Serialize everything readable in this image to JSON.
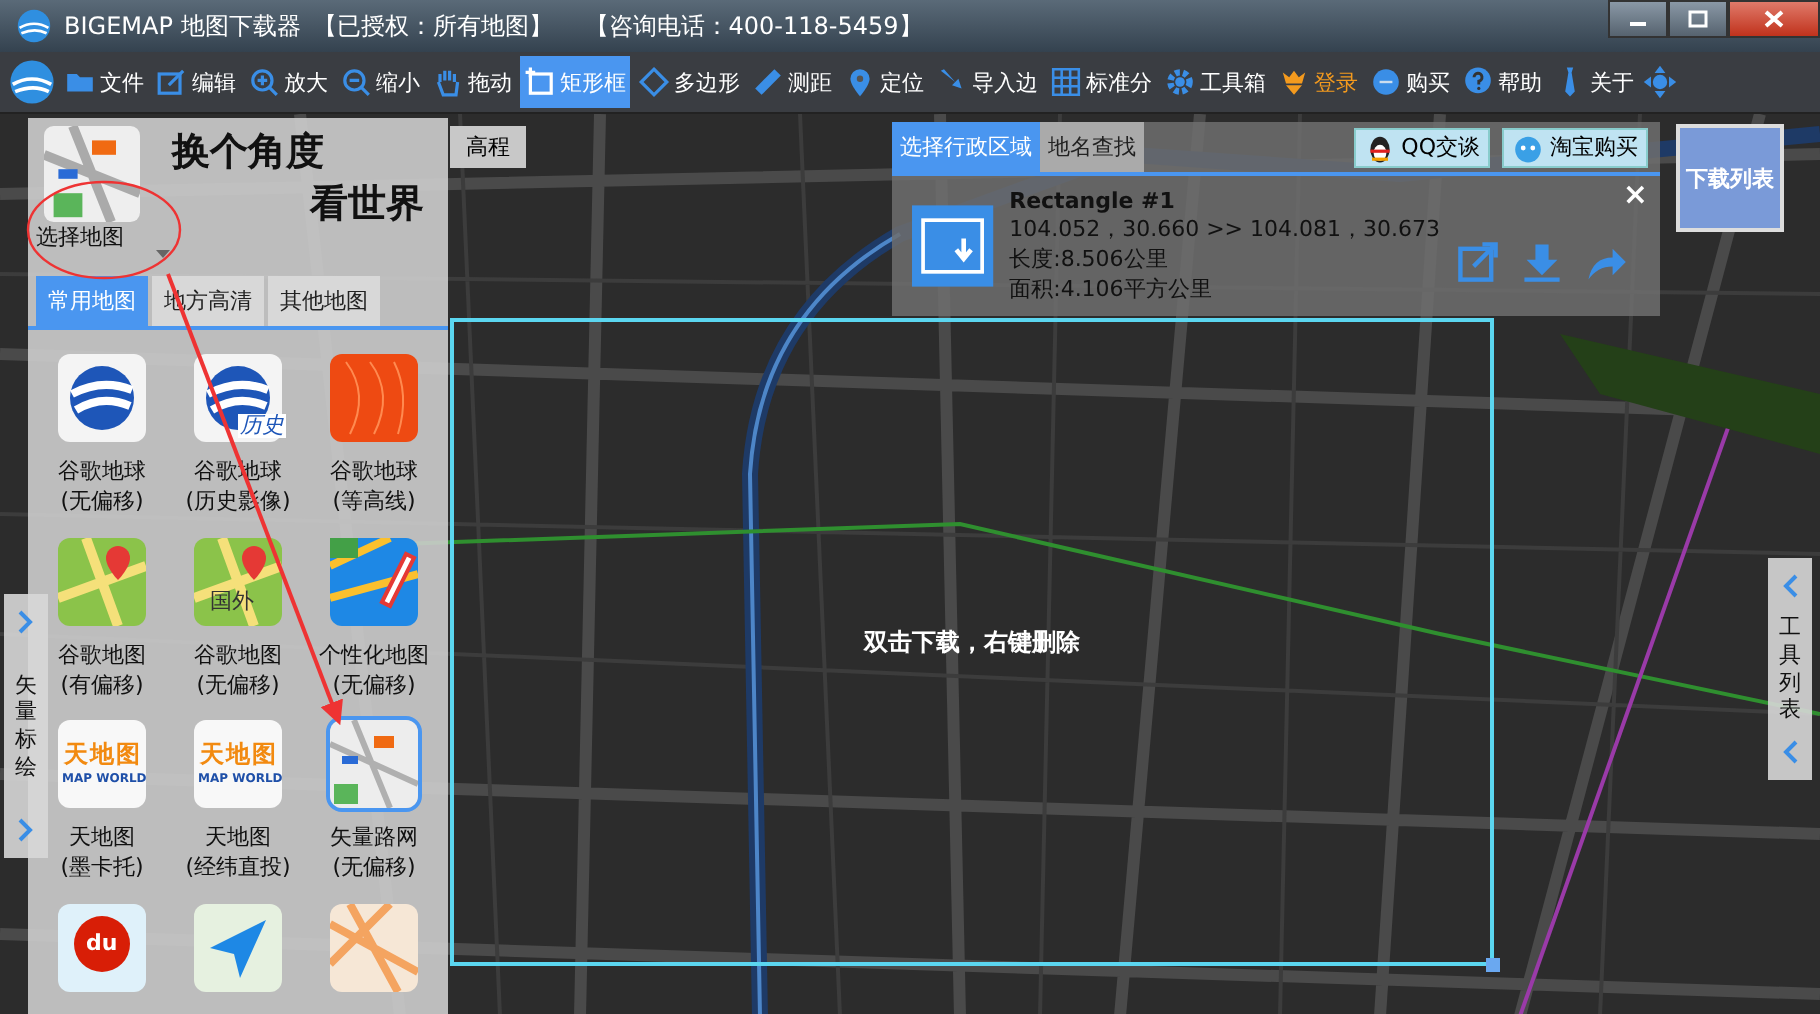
{
  "window": {
    "title": "BIGEMAP 地图下载器",
    "license": "【已授权：所有地图】",
    "phone": "【咨询电话：400-118-5459】"
  },
  "toolbar": [
    {
      "label": "文件",
      "selected": false,
      "accent": false
    },
    {
      "label": "编辑",
      "selected": false,
      "accent": false
    },
    {
      "label": "放大",
      "selected": false,
      "accent": false
    },
    {
      "label": "缩小",
      "selected": false,
      "accent": false
    },
    {
      "label": "拖动",
      "selected": false,
      "accent": false
    },
    {
      "label": "矩形框",
      "selected": true,
      "accent": false
    },
    {
      "label": "多边形",
      "selected": false,
      "accent": false
    },
    {
      "label": "测距",
      "selected": false,
      "accent": false
    },
    {
      "label": "定位",
      "selected": false,
      "accent": false
    },
    {
      "label": "导入边",
      "selected": false,
      "accent": false
    },
    {
      "label": "标准分",
      "selected": false,
      "accent": false
    },
    {
      "label": "工具箱",
      "selected": false,
      "accent": false
    },
    {
      "label": "登录",
      "selected": false,
      "accent": true
    },
    {
      "label": "购买",
      "selected": false,
      "accent": false
    },
    {
      "label": "帮助",
      "selected": false,
      "accent": false
    },
    {
      "label": "关于",
      "selected": false,
      "accent": false
    }
  ],
  "left_panel": {
    "picker_label": "选择地图",
    "slogan": [
      "换个角度",
      "看世界"
    ],
    "elevation_tab": "高程",
    "tabs": [
      {
        "label": "常用地图",
        "selected": true
      },
      {
        "label": "地方高清",
        "selected": false
      },
      {
        "label": "其他地图",
        "selected": false
      }
    ],
    "maps": [
      {
        "kind": "earth",
        "lines": [
          "谷歌地球",
          "(无偏移)"
        ],
        "selected": false
      },
      {
        "kind": "earth-history",
        "icon_text": "历史",
        "lines": [
          "谷歌地球",
          "(历史影像)"
        ],
        "selected": false
      },
      {
        "kind": "contour",
        "lines": [
          "谷歌地球",
          "(等高线)"
        ],
        "selected": false
      },
      {
        "kind": "gmap",
        "lines": [
          "谷歌地图",
          "(有偏移)"
        ],
        "selected": false
      },
      {
        "kind": "gmap",
        "icon_text": "国外",
        "lines": [
          "谷歌地图",
          "(无偏移)"
        ],
        "selected": false
      },
      {
        "kind": "custom",
        "lines": [
          "个性化地图",
          "(无偏移)"
        ],
        "selected": false
      },
      {
        "kind": "tianditu",
        "icon_text": "天地图",
        "icon_subtext": "MAP WORLD",
        "lines": [
          "天地图",
          "(墨卡托)"
        ],
        "selected": false
      },
      {
        "kind": "tianditu",
        "icon_text": "天地图",
        "icon_subtext": "MAP WORLD",
        "lines": [
          "天地图",
          "(经纬直投)"
        ],
        "selected": false
      },
      {
        "kind": "vector",
        "lines": [
          "矢量路网",
          "(无偏移)"
        ],
        "selected": true
      },
      {
        "kind": "baidu",
        "icon_text": "du",
        "selected": false
      },
      {
        "kind": "plane",
        "selected": false
      },
      {
        "kind": "street",
        "selected": false
      }
    ]
  },
  "left_side_tab": "矢量标绘",
  "right_side_tab": "工具列表",
  "region_panel": {
    "tabs": [
      {
        "label": "选择行政区域",
        "selected": true
      },
      {
        "label": "地名查找",
        "selected": false
      }
    ],
    "buttons": [
      {
        "label": "QQ交谈"
      },
      {
        "label": "淘宝购买"
      }
    ],
    "card": {
      "title": "Rectangle #1",
      "coords": "104.052，30.660 >> 104.081，30.673",
      "length": "长度:8.506公里",
      "area": "面积:4.106平方公里",
      "close": "×"
    }
  },
  "download_list_button": "下载列表",
  "selection": {
    "hint": "双击下载，右键删除"
  }
}
